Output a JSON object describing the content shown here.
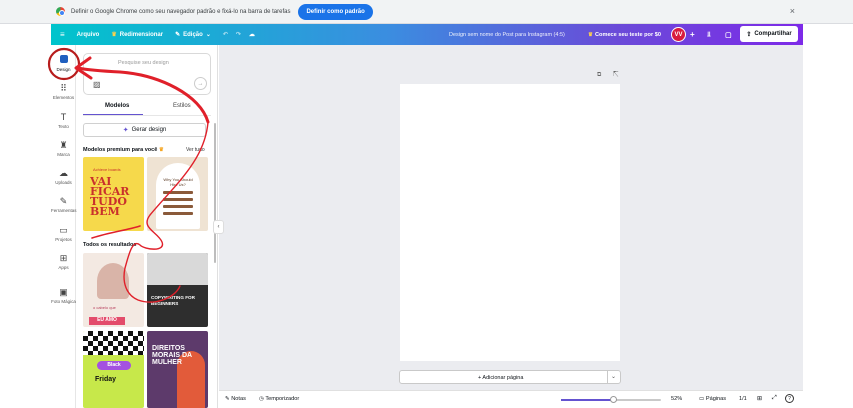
{
  "infobar": {
    "message": "Definir o Google Chrome como seu navegador padrão e fixá-lo na barra de tarefas",
    "button": "Definir como padrão",
    "close": "×"
  },
  "topbar": {
    "menu_icon": "≡",
    "file": "Arquivo",
    "resize": "Redimensionar",
    "edit": "Edição",
    "undo_icon": "↶",
    "redo_icon": "↷",
    "cloud_icon": "☁",
    "design_title": "Design sem nome do Post para Instagram (4:5)",
    "trial": "Comece seu teste por $0",
    "avatar": "VV",
    "plus": "+",
    "chart_icon": "⫫",
    "comment_icon": "▢",
    "share": "Compartilhar"
  },
  "rail": {
    "items": [
      {
        "label": "Design",
        "icon": "design-icon",
        "glyph": ""
      },
      {
        "label": "Elementos",
        "icon": "elements-icon",
        "glyph": "⠿"
      },
      {
        "label": "Texto",
        "icon": "text-icon",
        "glyph": "T"
      },
      {
        "label": "Marca",
        "icon": "brand-icon",
        "glyph": "♜"
      },
      {
        "label": "Uploads",
        "icon": "cloud-upload-icon",
        "glyph": "☁"
      },
      {
        "label": "Ferramentas",
        "icon": "pen-icon",
        "glyph": "✎"
      },
      {
        "label": "Projetos",
        "icon": "folder-icon",
        "glyph": "▭"
      },
      {
        "label": "Apps",
        "icon": "apps-icon",
        "glyph": "⊞"
      },
      {
        "label": "Foto Mágica",
        "icon": "magic-photo-icon",
        "glyph": "▣"
      }
    ]
  },
  "panel": {
    "search_placeholder": "Pesquise seu design",
    "image_icon": "▨",
    "go_icon": "→",
    "tab_models": "Modelos",
    "tab_styles": "Estilos",
    "generate": "Gerar design",
    "spark": "✦",
    "premium_title": "Modelos premium para você",
    "crown": "♛",
    "see_all": "Ver tudo",
    "all_results": "Todos os resultados",
    "collapse": "‹",
    "templates": {
      "t1_small": "Achieve boards",
      "t1_big": "VAI FICAR TUDO BEM",
      "t2_question": "Why You Should Hire Us?",
      "t3_text": "EU AMO",
      "t3_small": "o cabelo que",
      "t4_text": "COPYWRITING FOR BEGINNERS",
      "t5_pill": "Black",
      "t5_text": "Friday",
      "t6_text": "DIREITOS MORAIS DA MULHER"
    }
  },
  "canvas": {
    "page_tools": "⧉ ⇱",
    "add_page": "+ Adicionar página",
    "add_page_chevron": "⌄"
  },
  "bottombar": {
    "notes": "Notas",
    "notes_icon": "✎",
    "timer": "Temporizador",
    "timer_icon": "◷",
    "zoom": "52%",
    "zoom_level": 0.52,
    "pages": "Páginas",
    "pages_icon": "▭",
    "page_count": "1/1",
    "grid_icon": "⊞",
    "fullscreen_icon": "⤢",
    "help": "?"
  },
  "colors": {
    "brand_gradient_start": "#00c4cc",
    "brand_gradient_end": "#7d2ae8",
    "annotation_red": "#e0202a",
    "share_bg": "#ffffff",
    "avatar_bg": "#d81b3f"
  }
}
